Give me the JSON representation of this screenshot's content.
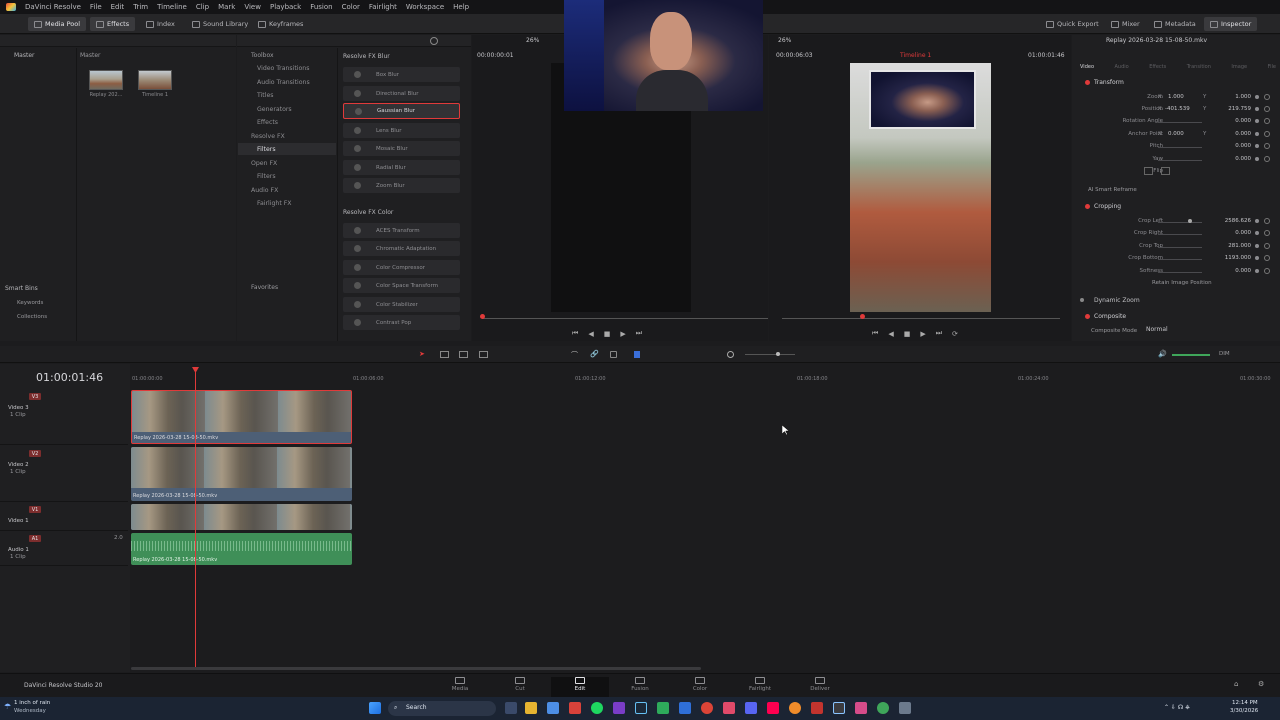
{
  "menubar": {
    "app_name": "DaVinci Resolve",
    "items": [
      "File",
      "Edit",
      "Trim",
      "Timeline",
      "Clip",
      "Mark",
      "View",
      "Playback",
      "Fusion",
      "Color",
      "Fairlight",
      "Workspace",
      "Help"
    ]
  },
  "toolbar": {
    "media_pool": "Media Pool",
    "effects": "Effects",
    "index": "Index",
    "sound_library": "Sound Library",
    "keyframes": "Keyframes",
    "quick_export": "Quick Export",
    "mixer": "Mixer",
    "metadata": "Metadata",
    "inspector": "Inspector"
  },
  "media_pool": {
    "bin_title": "Master",
    "content_title": "Master",
    "clips": [
      {
        "label": "Replay 202..."
      },
      {
        "label": "Timeline 1"
      }
    ],
    "smart_bins": "Smart Bins",
    "keywords": "Keywords",
    "collections": "Collections"
  },
  "effects_panel": {
    "toolbox_title": "Toolbox",
    "toolbox_items": [
      "Video Transitions",
      "Audio Transitions",
      "Titles",
      "Generators",
      "Effects"
    ],
    "openfx_title": "Resolve FX",
    "filters": "Filters",
    "open_fx": "Open FX",
    "open_filters": "Filters",
    "audio_fx": "Audio FX",
    "fairlight_fx": "Fairlight FX",
    "favorites": "Favorites",
    "group_blur": "Resolve FX Blur",
    "blur_items": [
      "Box Blur",
      "Directional Blur",
      "Gaussian Blur",
      "Lens Blur",
      "Mosaic Blur",
      "Radial Blur",
      "Zoom Blur"
    ],
    "selected_item": "Gaussian Blur",
    "group_color": "Resolve FX Color",
    "color_items": [
      "ACES Transform",
      "Chromatic Adaptation",
      "Color Compressor",
      "Color Space Transform",
      "Color Stabilizer",
      "Contrast Pop"
    ]
  },
  "source_viewer": {
    "zoom": "26%",
    "timecode": "00:00:00:01"
  },
  "timeline_viewer": {
    "zoom": "26%",
    "duration": "00:00:06:03",
    "timeline_name": "Timeline 1",
    "timecode": "01:00:01:46"
  },
  "inspector": {
    "clip_name": "Replay 2026-03-28 15-08-50.mkv",
    "tabs": [
      "Video",
      "Audio",
      "Effects",
      "Transition",
      "Image",
      "File"
    ],
    "transform_title": "Transform",
    "rows": [
      {
        "label": "Zoom",
        "x": "1.000",
        "y": "1.000"
      },
      {
        "label": "Position",
        "x": "-401.539",
        "y": "219.759"
      },
      {
        "label": "Rotation Angle",
        "value": "0.000"
      },
      {
        "label": "Anchor Point",
        "x": "0.000",
        "y": "0.000"
      },
      {
        "label": "Pitch",
        "value": "0.000"
      },
      {
        "label": "Yaw",
        "value": "0.000"
      },
      {
        "label": "Flip",
        "value": ""
      }
    ],
    "smart_reframe": "AI Smart Reframe",
    "cropping_title": "Cropping",
    "crop_rows": [
      {
        "label": "Crop Left",
        "value": "2586.626"
      },
      {
        "label": "Crop Right",
        "value": "0.000"
      },
      {
        "label": "Crop Top",
        "value": "281.000"
      },
      {
        "label": "Crop Bottom",
        "value": "1193.000"
      },
      {
        "label": "Softness",
        "value": "0.000"
      }
    ],
    "retain_position": "Retain Image Position",
    "dynamic_zoom": "Dynamic Zoom",
    "composite": "Composite",
    "composite_mode_label": "Composite Mode",
    "composite_mode_value": "Normal"
  },
  "timeline": {
    "current_timecode": "01:00:01:46",
    "ruler_ticks": [
      "01:00:00:00",
      "01:00:06:00",
      "01:00:12:00",
      "01:00:18:00",
      "01:00:24:00",
      "01:00:30:00"
    ],
    "audio_level": "DIM",
    "tracks": [
      {
        "badge": "V3",
        "name": "Video 3",
        "count": "1 Clip",
        "clip": "Replay 2026-03-28 15-08-50.mkv"
      },
      {
        "badge": "V2",
        "name": "Video 2",
        "count": "1 Clip",
        "clip": "Replay 2026-03-28 15-08-50.mkv"
      },
      {
        "badge": "V1",
        "name": "Video 1",
        "count": "",
        "clip": ""
      },
      {
        "badge": "A1",
        "name": "Audio 1",
        "count": "1 Clip",
        "clip": "Replay 2026-03-28 15-08-50.mkv",
        "channels": "2.0"
      }
    ]
  },
  "pagenav": {
    "brand": "DaVinci Resolve Studio 20",
    "pages": [
      "Media",
      "Cut",
      "Edit",
      "Fusion",
      "Color",
      "Fairlight",
      "Deliver"
    ],
    "active": "Edit"
  },
  "taskbar": {
    "weather_line1": "1 inch of rain",
    "weather_line2": "Wednesday",
    "search": "Search",
    "time": "12:14 PM",
    "date": "3/30/2026"
  },
  "colors": {
    "accent_red": "#e03a3a",
    "video_clip": "#4d5f76",
    "audio_clip": "#3f8f58"
  }
}
